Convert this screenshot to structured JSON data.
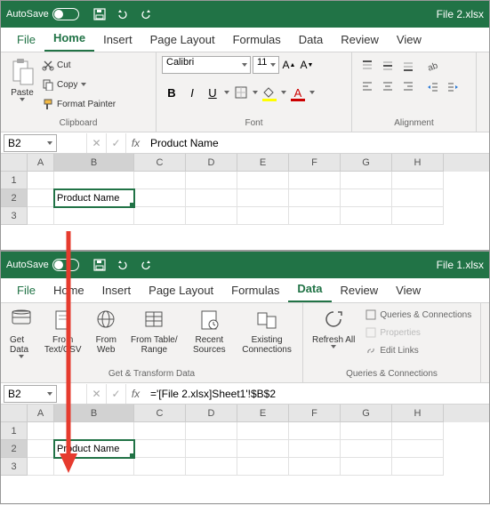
{
  "win1": {
    "autosave_text": "AutoSave",
    "filename": "File 2.xlsx",
    "tabs": [
      "File",
      "Home",
      "Insert",
      "Page Layout",
      "Formulas",
      "Data",
      "Review",
      "View"
    ],
    "active_tab": "Home",
    "clipboard": {
      "paste": "Paste",
      "cut": "Cut",
      "copy": "Copy",
      "format_painter": "Format Painter",
      "label": "Clipboard"
    },
    "font": {
      "name": "Calibri",
      "size": "11",
      "label": "Font"
    },
    "alignment_label": "Alignment",
    "name_box": "B2",
    "formula_value": "Product Name",
    "cell_b2": "Product Name",
    "columns": [
      "A",
      "B",
      "C",
      "D",
      "E",
      "F",
      "G",
      "H"
    ],
    "rows": [
      "1",
      "2",
      "3"
    ]
  },
  "win2": {
    "autosave_text": "AutoSave",
    "filename": "File 1.xlsx",
    "tabs": [
      "File",
      "Home",
      "Insert",
      "Page Layout",
      "Formulas",
      "Data",
      "Review",
      "View"
    ],
    "active_tab": "Data",
    "data_ribbon": {
      "get_data": "Get Data",
      "from_textcsv": "From Text/CSV",
      "from_web": "From Web",
      "from_table": "From Table/ Range",
      "recent_sources": "Recent Sources",
      "existing_conn": "Existing Connections",
      "group1_label": "Get & Transform Data",
      "refresh_all": "Refresh All",
      "queries": "Queries & Connections",
      "properties": "Properties",
      "edit_links": "Edit Links",
      "group2_label": "Queries & Connections"
    },
    "name_box": "B2",
    "formula_value": "='[File 2.xlsx]Sheet1'!$B$2",
    "cell_b2": "Product Name",
    "columns": [
      "A",
      "B",
      "C",
      "D",
      "E",
      "F",
      "G",
      "H"
    ],
    "rows": [
      "1",
      "2",
      "3"
    ]
  }
}
